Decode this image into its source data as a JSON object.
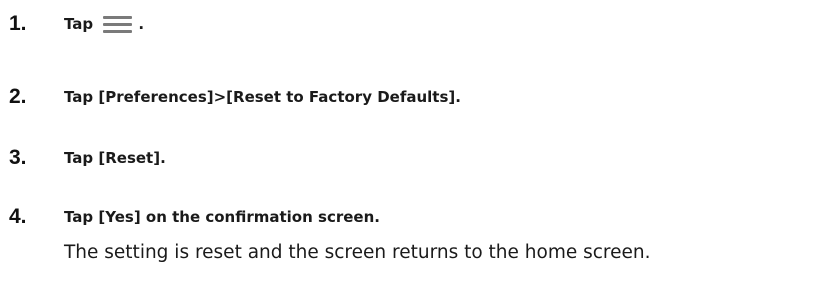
{
  "steps": [
    {
      "number": "1.",
      "prefix": "Tap",
      "icon": "hamburger-menu-icon",
      "suffix": "."
    },
    {
      "number": "2.",
      "text": "Tap [Preferences]>[Reset to Factory Defaults]."
    },
    {
      "number": "3.",
      "text": "Tap [Reset]."
    },
    {
      "number": "4.",
      "text": "Tap [Yes] on the confirmation screen.",
      "result": "The setting is reset and the screen returns to the home screen."
    }
  ],
  "colors": {
    "text": "#1a1a1a",
    "icon": "#7a7a7a",
    "background": "#ffffff"
  }
}
